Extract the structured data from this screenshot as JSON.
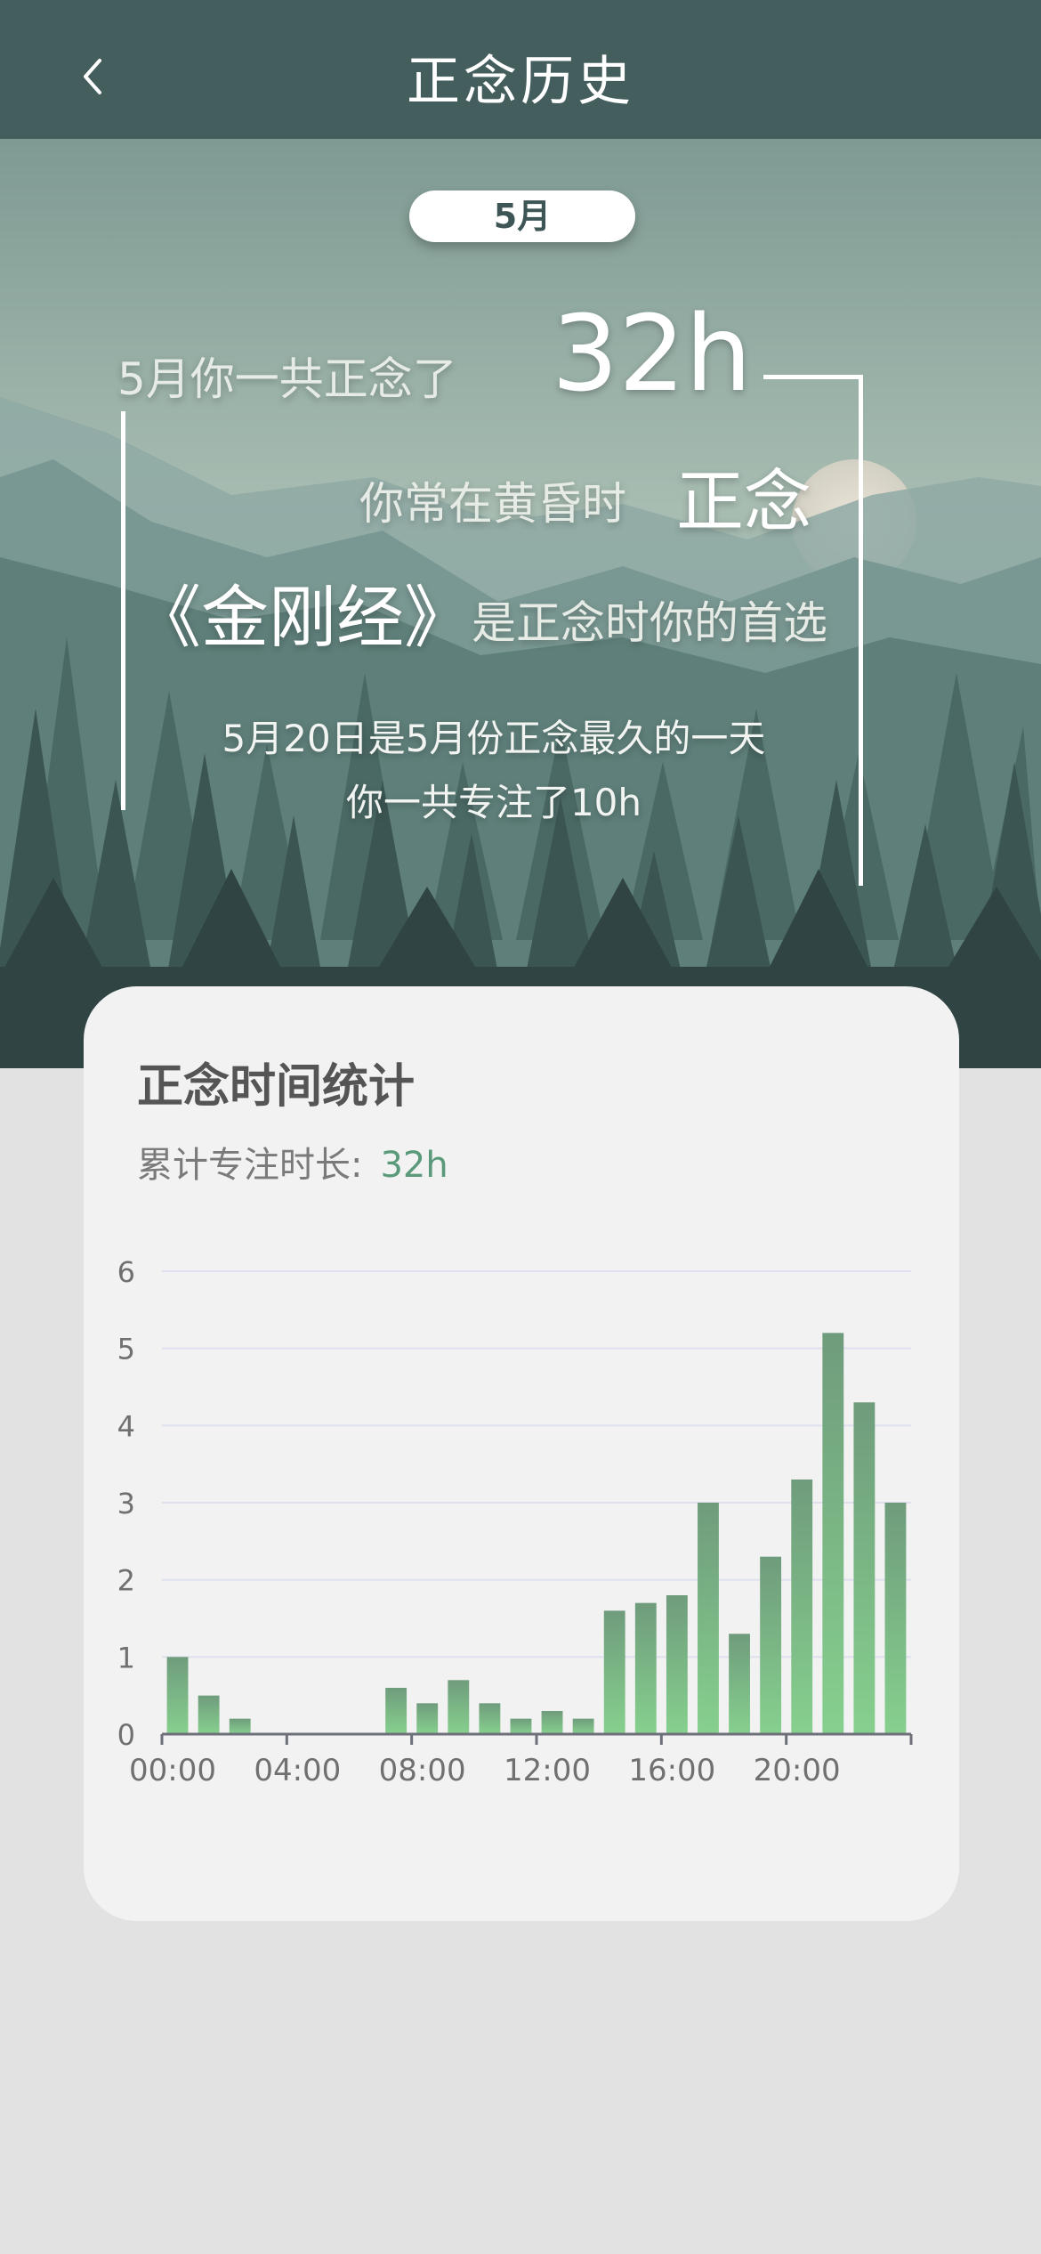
{
  "header": {
    "title": "正念历史",
    "back_icon": "chevron-left-icon"
  },
  "hero": {
    "month_label": "5月",
    "summary_prefix": "5月你一共正念了",
    "total_hours": "32h",
    "habit_prefix": "你常在黄昏时",
    "habit_highlight": "正念",
    "favorite_sutra": "《金刚经》",
    "favorite_suffix": "是正念时你的首选",
    "best_day_line": "5月20日是5月份正念最久的一天",
    "best_day_focus": "你一共专注了10h"
  },
  "stats": {
    "title": "正念时间统计",
    "total_label": "累计专注时长:",
    "total_value": "32h"
  },
  "chart_data": {
    "type": "bar",
    "categories": [
      "00:00",
      "01:00",
      "02:00",
      "03:00",
      "04:00",
      "05:00",
      "06:00",
      "07:00",
      "08:00",
      "09:00",
      "10:00",
      "11:00",
      "12:00",
      "13:00",
      "14:00",
      "15:00",
      "16:00",
      "17:00",
      "18:00",
      "19:00",
      "20:00",
      "21:00",
      "22:00",
      "23:00"
    ],
    "values": [
      1,
      0.5,
      0.2,
      0,
      0,
      0,
      0,
      0.6,
      0.4,
      0.7,
      0.4,
      0.2,
      0.3,
      0.2,
      1.6,
      1.7,
      1.8,
      3,
      1.3,
      2.3,
      3.3,
      5.2,
      4.3,
      3
    ],
    "x_tick_labels": [
      "00:00",
      "04:00",
      "08:00",
      "12:00",
      "16:00",
      "20:00"
    ],
    "y_ticks": [
      0,
      1,
      2,
      3,
      4,
      5,
      6
    ],
    "ylim": [
      0,
      6
    ],
    "grid": true,
    "bar_color_top": "#6f9c7c",
    "bar_color_bottom": "#86d08e"
  }
}
